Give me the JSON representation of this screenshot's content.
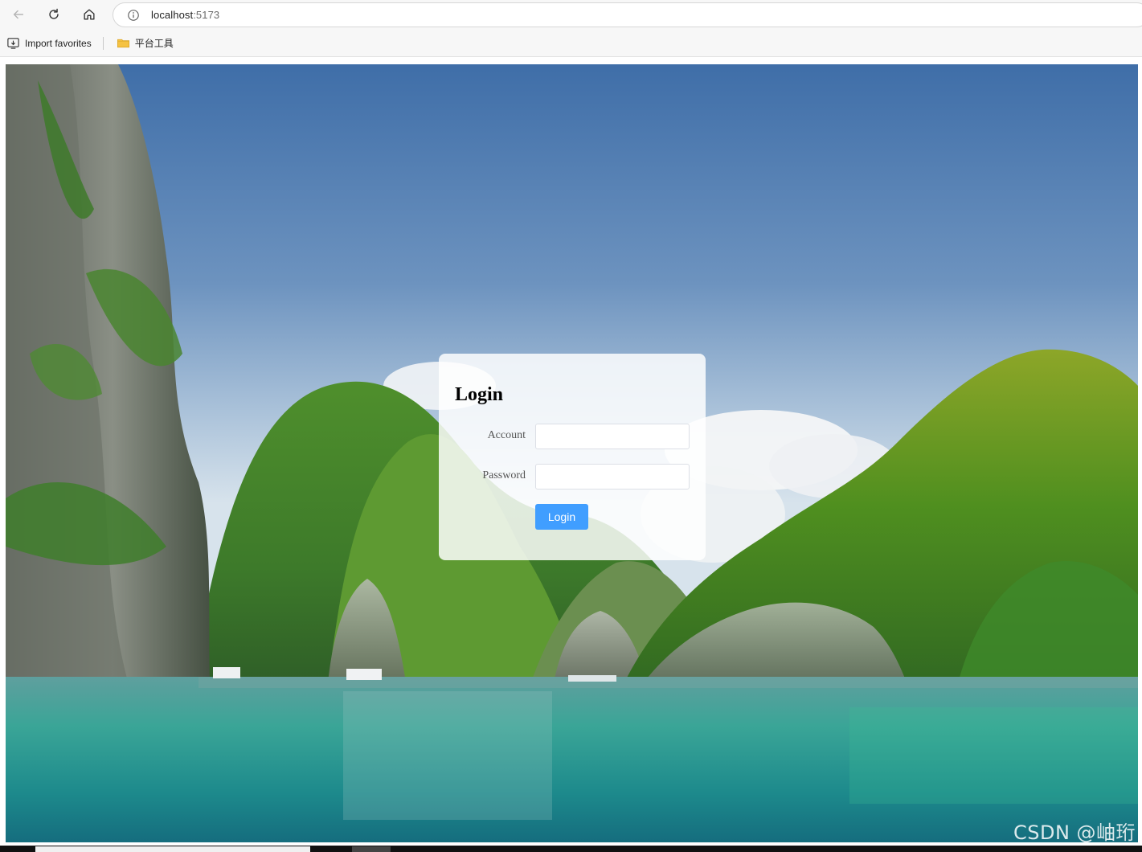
{
  "browser": {
    "url_host": "localhost",
    "url_port": ":5173",
    "favorites": [
      {
        "label": "Import favorites",
        "icon": "import-favorites-icon"
      },
      {
        "label": "平台工具",
        "icon": "folder-icon"
      }
    ]
  },
  "login": {
    "title": "Login",
    "account_label": "Account",
    "account_value": "",
    "password_label": "Password",
    "password_value": "",
    "submit_label": "Login"
  },
  "watermark": "CSDN @岫珩",
  "colors": {
    "button_primary": "#409eff",
    "card_background": "rgba(255,255,255,0.84)",
    "folder": "#f5c242"
  },
  "background": {
    "description_icon": "landscape-image"
  }
}
